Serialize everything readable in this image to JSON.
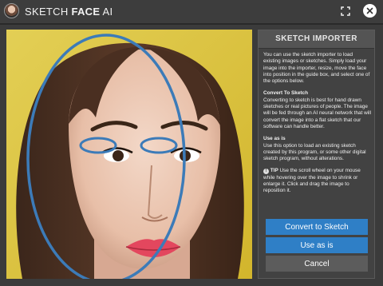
{
  "app": {
    "title_light": "SKETCH",
    "title_bold": "FACE",
    "title_suffix": "AI"
  },
  "panel": {
    "title": "SKETCH IMPORTER",
    "intro": "You can use the sketch importer to load existing images or sketches. Simply load your image into the importer, resize, move the face into position in the guide box, and select one of the options below.",
    "convert_heading": "Convert To Sketch",
    "convert_text": "Converting to sketch is best for hand drawn sketches or real pictures of people. The image will be fed through an AI neural network that will convert the image into a flat sketch that our software can handle better.",
    "useasis_heading": "Use as is",
    "useasis_text": "Use this option to load an existing sketch created by this program, or some other digital sketch program, without alterations.",
    "tip_label": "TIP",
    "tip_text": "Use the scroll wheel on your mouse while hovering over the image to shrink or enlarge it. Click and drag the image to reposition it."
  },
  "buttons": {
    "convert": "Convert to Sketch",
    "use_as_is": "Use as is",
    "cancel": "Cancel"
  },
  "icons": {
    "logo": "app-logo-icon",
    "expand": "expand-icon",
    "close": "close-icon",
    "tip": "info-icon"
  },
  "colors": {
    "accent": "#2f7fc6",
    "guide": "#3c7bb8",
    "background": "#3b3b3b"
  }
}
